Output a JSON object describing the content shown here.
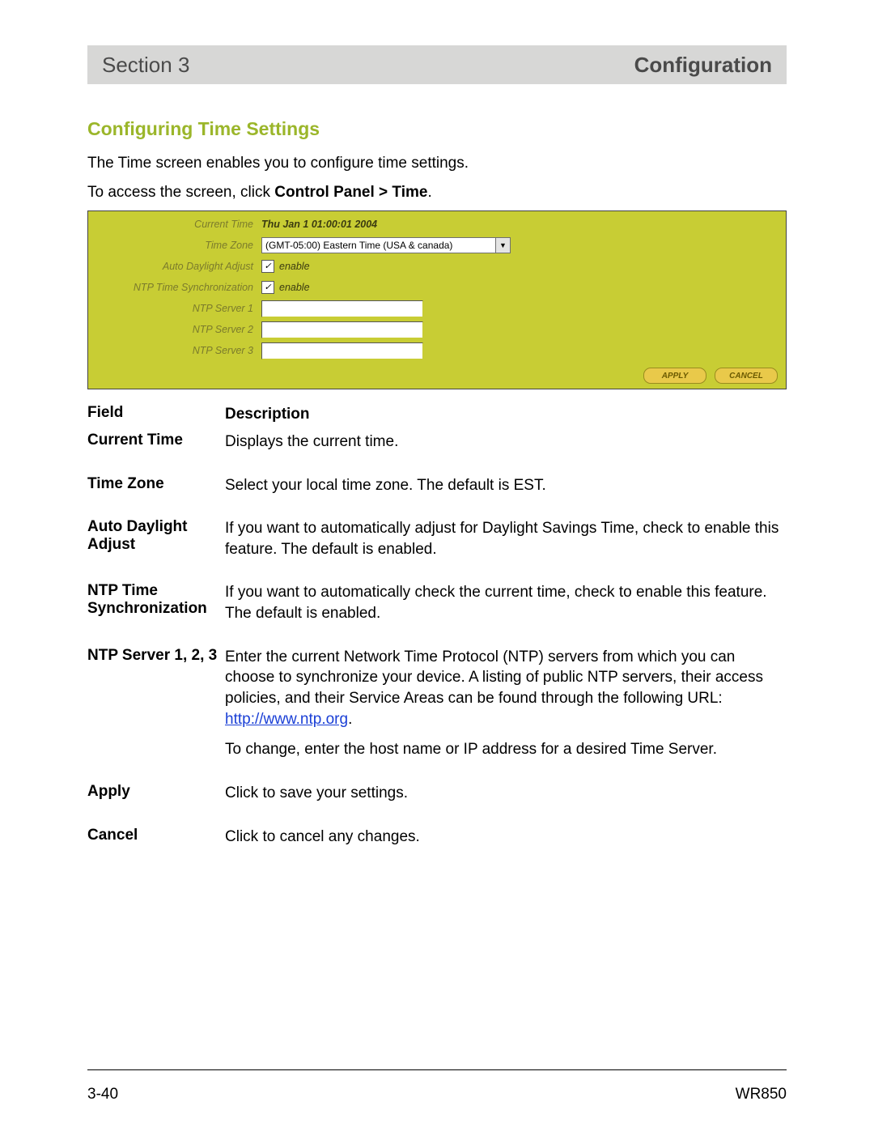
{
  "header": {
    "section_label": "Section 3",
    "title": "Configuration"
  },
  "subhead": "Configuring Time Settings",
  "intro": {
    "p1": "The Time screen enables you to configure time settings.",
    "p2_pre": "To access the screen, click ",
    "p2_strong": "Control Panel > Time",
    "p2_post": "."
  },
  "panel": {
    "labels": {
      "current_time": "Current Time",
      "time_zone": "Time Zone",
      "auto_daylight": "Auto Daylight Adjust",
      "ntp_sync": "NTP Time Synchronization",
      "ntp1": "NTP Server 1",
      "ntp2": "NTP Server 2",
      "ntp3": "NTP Server 3"
    },
    "current_time_value": "Thu Jan 1 01:00:01 2004",
    "time_zone_value": "(GMT-05:00) Eastern Time (USA & canada)",
    "enable_text": "enable",
    "buttons": {
      "apply": "APPLY",
      "cancel": "CANCEL"
    }
  },
  "table": {
    "header": {
      "field": "Field",
      "desc": "Description"
    },
    "rows": [
      {
        "field": "Current Time",
        "desc": "Displays the current time."
      },
      {
        "field": "Time Zone",
        "desc": "Select your local time zone. The default is EST."
      },
      {
        "field": "Auto Daylight Adjust",
        "desc": "If you want to automatically adjust for Daylight Savings Time, check to enable this feature. The default is enabled."
      },
      {
        "field": "NTP Time Synchronization",
        "desc": "If you want to automatically check the current time, check to enable this feature. The default is enabled."
      },
      {
        "field": "NTP Server 1, 2, 3",
        "desc": "Enter the current Network Time Protocol (NTP) servers from which you can choose to synchronize your device. A listing of public NTP servers, their access policies, and their Service Areas can be found through the following URL: ",
        "link_text": "http://www.ntp.org",
        "desc_post": ".",
        "desc2": "To change, enter the host name or IP address for a desired Time Server."
      },
      {
        "field": "Apply",
        "desc": "Click to save your settings."
      },
      {
        "field": "Cancel",
        "desc": "Click to cancel any changes."
      }
    ]
  },
  "footer": {
    "page": "3-40",
    "model": "WR850"
  }
}
